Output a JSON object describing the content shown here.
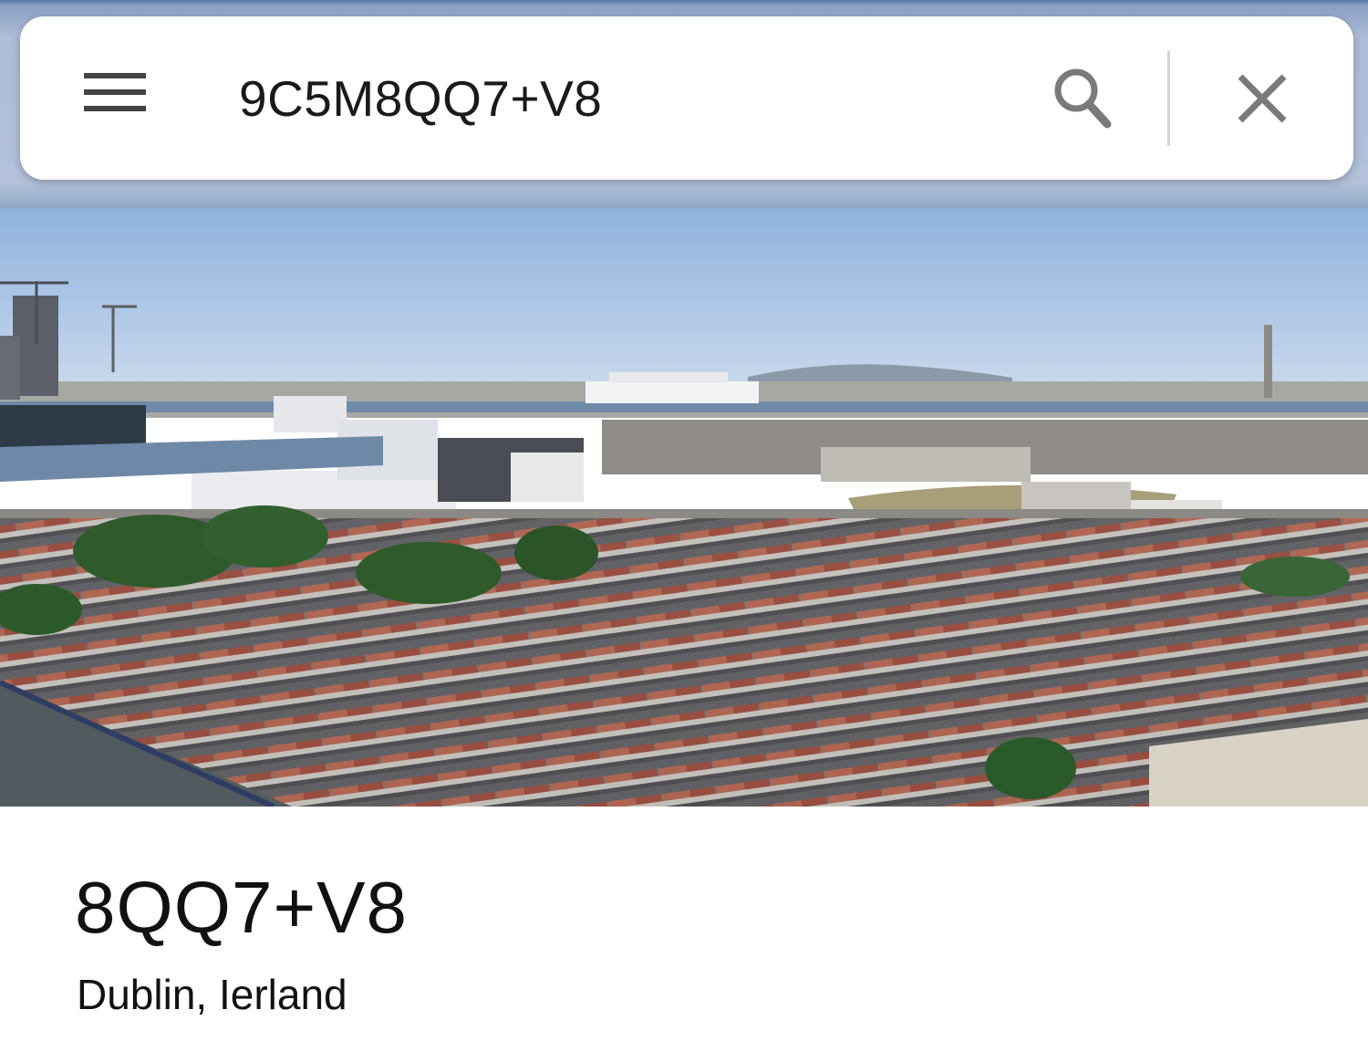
{
  "search": {
    "query": "9C5M8QQ7+V8",
    "menu_icon": "hamburger-menu-icon",
    "search_icon": "search-icon",
    "close_icon": "close-icon"
  },
  "photo": {
    "subject": "aerial city view with harbor and cruise ship"
  },
  "place": {
    "title": "8QQ7+V8",
    "subtitle": "Dublin, Ierland"
  },
  "colors": {
    "sky": "#a9c3e6",
    "roof_red": "#9c4a3c",
    "roof_grey": "#6d6f74",
    "tree_green": "#2f5a2c"
  }
}
